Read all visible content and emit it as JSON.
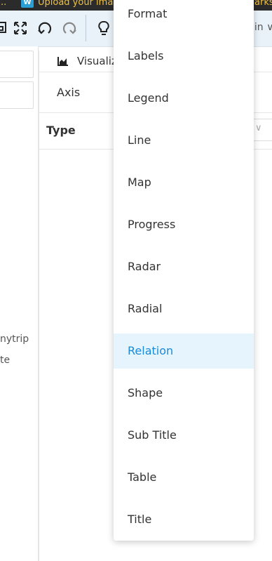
{
  "bookmarks": {
    "overflow": "..",
    "item1": "Upload your images",
    "item1_favicon": "W",
    "more": "»",
    "item2": "Other Bookmarks"
  },
  "toolbar": {
    "user_text": "nin",
    "icons": [
      "save-icon",
      "fullscreen-icon",
      "undo-icon",
      "redo-icon",
      "lightbulb-icon"
    ]
  },
  "left_panel": {
    "text1": "nytrip",
    "text2": "te"
  },
  "main": {
    "tab_label": "Visualiz",
    "axis_label": "Axis",
    "type_label": "Type",
    "type_chevron": "∨"
  },
  "dropdown": {
    "items": [
      "Format",
      "Labels",
      "Legend",
      "Line",
      "Map",
      "Progress",
      "Radar",
      "Radial",
      "Relation",
      "Shape",
      "Sub Title",
      "Table",
      "Title"
    ],
    "selected": "Relation",
    "selected_color": "#1a8ad8",
    "selected_bg": "#e6f4fd"
  }
}
